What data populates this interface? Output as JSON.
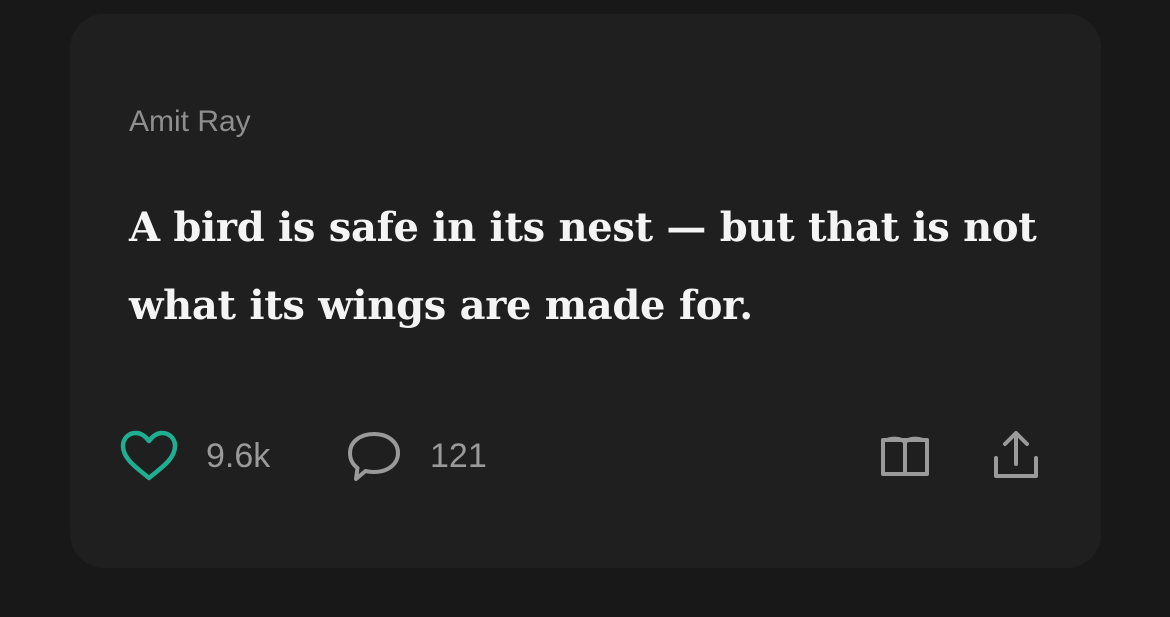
{
  "post": {
    "author": "Amit Ray",
    "quote": "A bird is safe in its nest — but that is not what its wings are made for."
  },
  "actions": {
    "like": {
      "icon": "heart-icon",
      "count": "9.6k",
      "color": "#1fae8f"
    },
    "comment": {
      "icon": "comment-bubble-icon",
      "count": "121"
    },
    "read": {
      "icon": "book-icon"
    },
    "share": {
      "icon": "share-icon"
    }
  }
}
